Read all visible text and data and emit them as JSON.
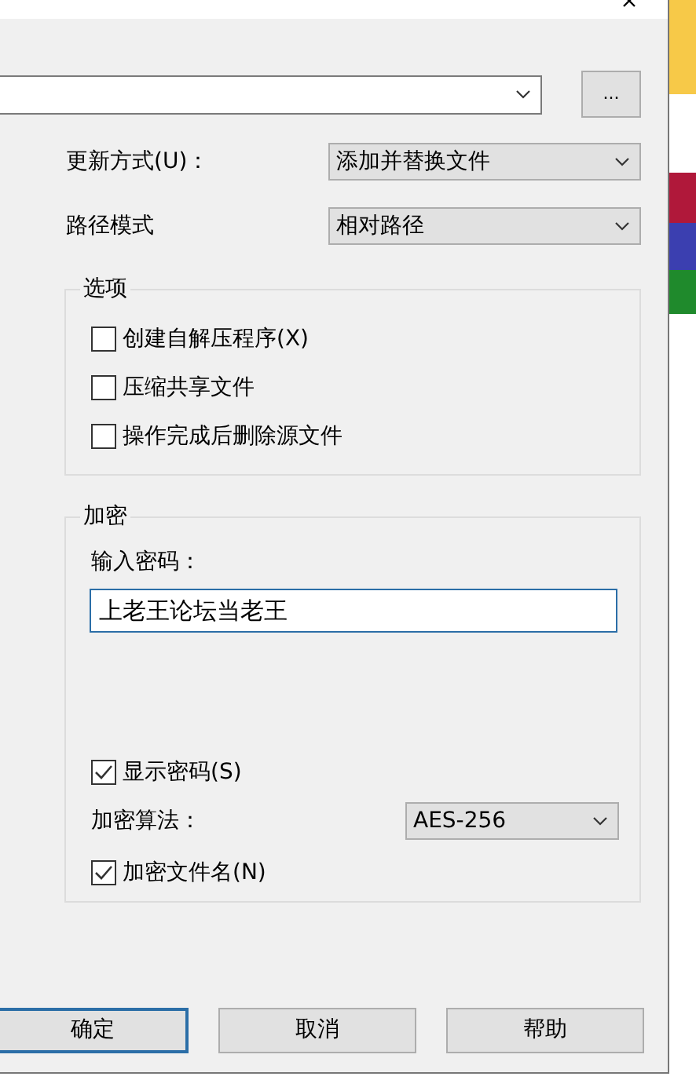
{
  "archive_path": {
    "browse": "..."
  },
  "update_mode": {
    "label": "更新方式(U)：",
    "value": "添加并替换文件"
  },
  "path_mode": {
    "label": "路径模式",
    "value": "相对路径"
  },
  "options": {
    "title": "选项",
    "items": [
      {
        "label": "创建自解压程序(X)",
        "checked": false
      },
      {
        "label": "压缩共享文件",
        "checked": false
      },
      {
        "label": "操作完成后删除源文件",
        "checked": false
      }
    ]
  },
  "encryption": {
    "title": "加密",
    "password_label": "输入密码：",
    "password": "上老王论坛当老王",
    "show_password": {
      "label": "显示密码(S)",
      "checked": true
    },
    "algorithm": {
      "label": "加密算法：",
      "value": "AES-256"
    },
    "encrypt_names": {
      "label": "加密文件名(N)",
      "checked": true
    }
  },
  "buttons": [
    {
      "label": "确定",
      "selected": true
    },
    {
      "label": "取消",
      "selected": false
    },
    {
      "label": "帮助",
      "selected": false
    }
  ]
}
